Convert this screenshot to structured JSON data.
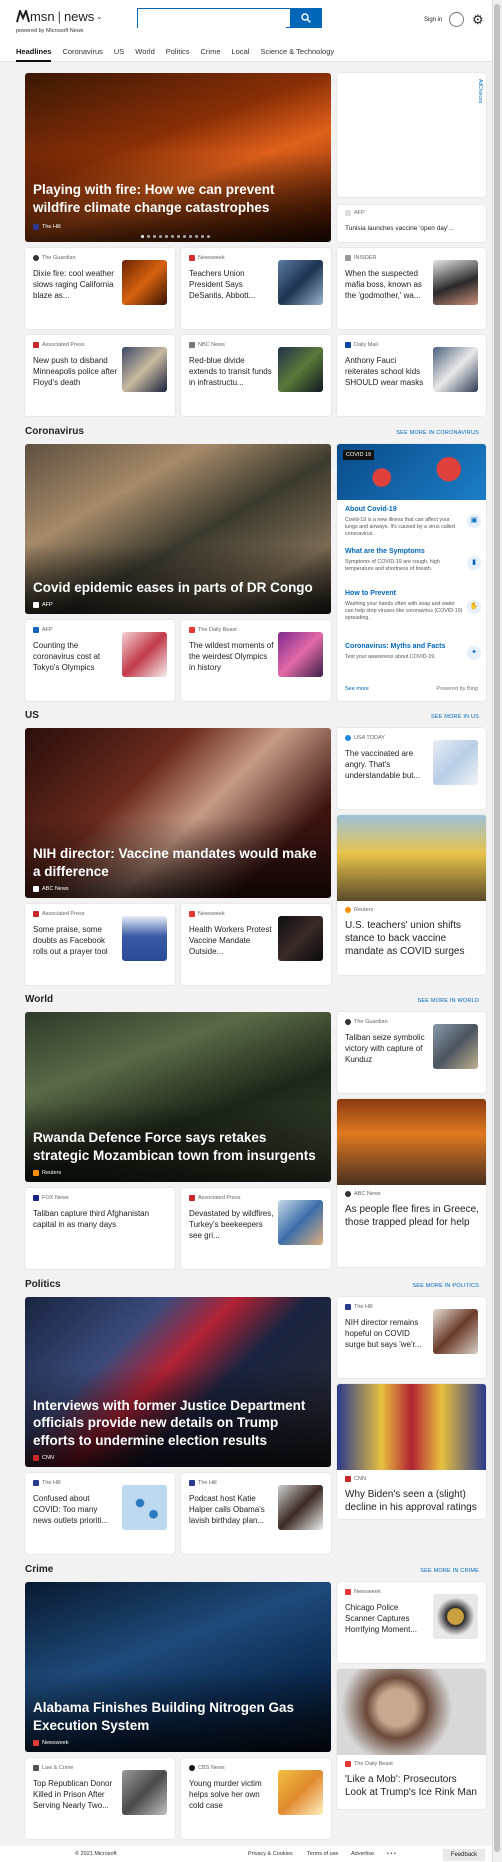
{
  "header": {
    "logo": "msn",
    "logo_sep": "|",
    "brand": "news",
    "powered_by": "powered by Microsoft News",
    "search_value": "",
    "signin": "Sign in"
  },
  "nav": [
    "Headlines",
    "Coronavirus",
    "US",
    "World",
    "Politics",
    "Crime",
    "Local",
    "Science & Technology"
  ],
  "top": {
    "hero": {
      "title": "Playing with fire: How we can prevent wildfire climate change catastrophes",
      "source": "The Hill"
    },
    "side": {
      "source": "AFP",
      "title": "Tunisia launches vaccine 'open day'..."
    },
    "adchoices": "AdChoices",
    "cards": [
      {
        "source": "The Guardian",
        "title": "Dixie fire: cool weather slows raging California blaze as..."
      },
      {
        "source": "Newsweek",
        "title": "Teachers Union President Says DeSantis, Abbott..."
      },
      {
        "source": "INSIDER",
        "title": "When the suspected mafia boss, known as the 'godmother,' wa..."
      },
      {
        "source": "Associated Press",
        "title": "New push to disband Minneapolis police after Floyd's death"
      },
      {
        "source": "NBC News",
        "title": "Red-blue divide extends to transit funds in infrastructu..."
      },
      {
        "source": "Daily Mail",
        "title": "Anthony Fauci reiterates school kids SHOULD wear masks"
      }
    ]
  },
  "corona": {
    "heading": "Coronavirus",
    "more": "SEE MORE IN CORONAVIRUS",
    "hero": {
      "title": "Covid epidemic eases in parts of DR Congo",
      "source": "AFP"
    },
    "cards": [
      {
        "source": "AFP",
        "title": "Counting the coronavirus cost at Tokyo's Olympics"
      },
      {
        "source": "The Daily Beast",
        "title": "The wildest moments of the weirdest Olympics in history"
      }
    ],
    "widget": {
      "badge": "COVID 19",
      "items": [
        {
          "label": "About Covid-19",
          "text": "Covid-19 is a new illness that can affect your lungs and airways. It's caused by a virus called coronavirus."
        },
        {
          "label": "What are the Symptoms",
          "text": "Symptoms of COVID-19 are cough, high temperature and shortness of breath."
        },
        {
          "label": "How to Prevent",
          "text": "Washing your hands often with soap and water can help stop viruses like coronavirus (COVID-19) spreading."
        },
        {
          "label": "Coronavirus: Myths and Facts",
          "text": "Test your awareness about COVID-19."
        }
      ],
      "see_more": "See more",
      "powered": "Powered by Bing"
    }
  },
  "us": {
    "heading": "US",
    "more": "SEE MORE IN US",
    "hero": {
      "title": "NIH director: Vaccine mandates would make a difference",
      "source": "ABC News"
    },
    "side": {
      "source": "USA TODAY",
      "title": "The vaccinated are angry. That's understandable but..."
    },
    "cards": [
      {
        "source": "Associated Press",
        "title": "Some praise, some doubts as Facebook rolls out a prayer tool"
      },
      {
        "source": "Newsweek",
        "title": "Health Workers Protest Vaccine Mandate Outside..."
      }
    ],
    "big": {
      "source": "Reuters",
      "title": "U.S. teachers' union shifts stance to back vaccine mandate as COVID surges"
    }
  },
  "world": {
    "heading": "World",
    "more": "SEE MORE IN WORLD",
    "hero": {
      "title": "Rwanda Defence Force says retakes strategic Mozambican town from insurgents",
      "source": "Reuters"
    },
    "side": {
      "source": "The Guardian",
      "title": "Taliban seize symbolic victory with capture of Kunduz"
    },
    "cards": [
      {
        "source": "FOX News",
        "title": "Taliban capture third Afghanistan capital in as many days"
      },
      {
        "source": "Associated Press",
        "title": "Devastated by wildfires, Turkey's beekeepers see gri..."
      }
    ],
    "big": {
      "source": "ABC News",
      "title": "As people flee fires in Greece, those trapped plead for help"
    }
  },
  "politics": {
    "heading": "Politics",
    "more": "SEE MORE IN POLITICS",
    "hero": {
      "title": "Interviews with former Justice Department officials provide new details on Trump efforts to undermine election results",
      "source": "CNN"
    },
    "side": {
      "source": "The Hill",
      "title": "NIH director remains hopeful on COVID surge but says 'we'r..."
    },
    "cards": [
      {
        "source": "The Hill",
        "title": "Confused about COVID: Too many news outlets prioriti..."
      },
      {
        "source": "The Hill",
        "title": "Podcast host Katie Halper calls Obama's lavish birthday plan..."
      }
    ],
    "big": {
      "source": "CNN",
      "title": "Why Biden's seen a (slight) decline in his approval ratings"
    }
  },
  "crime": {
    "heading": "Crime",
    "more": "SEE MORE IN CRIME",
    "hero": {
      "title": "Alabama Finishes Building Nitrogen Gas Execution System",
      "source": "Newsweek"
    },
    "side": {
      "source": "Newsweek",
      "title": "Chicago Police Scanner Captures Horrifying Moment..."
    },
    "cards": [
      {
        "source": "Law & Crime",
        "title": "Top Republican Donor Killed in Prison After Serving Nearly Two..."
      },
      {
        "source": "CBS News",
        "title": "Young murder victim helps solve her own cold case"
      }
    ],
    "big": {
      "source": "The Daily Beast",
      "title": "'Like a Mob': Prosecutors Look at Trump's Ice Rink Man"
    }
  },
  "footer": {
    "copyright": "© 2021 Microsoft",
    "privacy": "Privacy & Cookies",
    "terms": "Terms of use",
    "advertise": "Advertise",
    "more": "• • •",
    "feedback": "Feedback"
  },
  "colors": {
    "accent": "#0067b8"
  }
}
